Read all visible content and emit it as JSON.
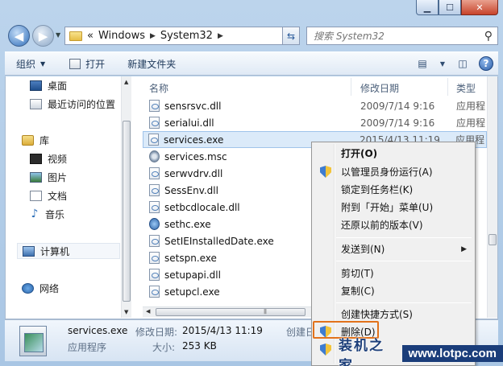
{
  "address": {
    "crumbs": [
      "Windows",
      "System32"
    ],
    "overflow": "«"
  },
  "search": {
    "placeholder": "搜索 System32"
  },
  "toolbar": {
    "organize": "组织",
    "open": "打开",
    "new_folder": "新建文件夹"
  },
  "nav": {
    "desktop": "桌面",
    "recent": "最近访问的位置",
    "libraries": "库",
    "videos": "视频",
    "pictures": "图片",
    "documents": "文档",
    "music": "音乐",
    "computer": "计算机",
    "network": "网络"
  },
  "columns": {
    "name": "名称",
    "date": "修改日期",
    "type": "类型"
  },
  "files": [
    {
      "name": "sensrsvc.dll",
      "date": "2009/7/14 9:16",
      "type": "应用程"
    },
    {
      "name": "serialui.dll",
      "date": "2009/7/14 9:16",
      "type": "应用程"
    },
    {
      "name": "services.exe",
      "date": "2015/4/13 11:19",
      "type": "应用程"
    },
    {
      "name": "services.msc",
      "date": "",
      "type": ""
    },
    {
      "name": "serwvdrv.dll",
      "date": "",
      "type": ""
    },
    {
      "name": "SessEnv.dll",
      "date": "",
      "type": ""
    },
    {
      "name": "setbcdlocale.dll",
      "date": "",
      "type": ""
    },
    {
      "name": "sethc.exe",
      "date": "",
      "type": ""
    },
    {
      "name": "SetIEInstalledDate.exe",
      "date": "",
      "type": ""
    },
    {
      "name": "setspn.exe",
      "date": "",
      "type": ""
    },
    {
      "name": "setupapi.dll",
      "date": "",
      "type": ""
    },
    {
      "name": "setupcl.exe",
      "date": "",
      "type": ""
    }
  ],
  "context_menu": {
    "open": "打开(O)",
    "run_as_admin": "以管理员身份运行(A)",
    "pin_taskbar": "锁定到任务栏(K)",
    "pin_start": "附到「开始」菜单(U)",
    "restore": "还原以前的版本(V)",
    "send_to": "发送到(N)",
    "cut": "剪切(T)",
    "copy": "复制(C)",
    "shortcut": "创建快捷方式(S)",
    "delete": "删除(D)"
  },
  "details": {
    "name": "services.exe",
    "modified_label": "修改日期:",
    "modified_value": "2015/4/13 11:19",
    "created_label": "创建日",
    "kind": "应用程序",
    "size_label": "大小:",
    "size_value": "253 KB"
  },
  "watermark": {
    "text": "装机之家",
    "url": "www.lotpc.com"
  },
  "colors": {
    "selection": "#dbeaf9",
    "highlight_box": "#e2721b",
    "menu_bg": "#f0f0f0"
  }
}
